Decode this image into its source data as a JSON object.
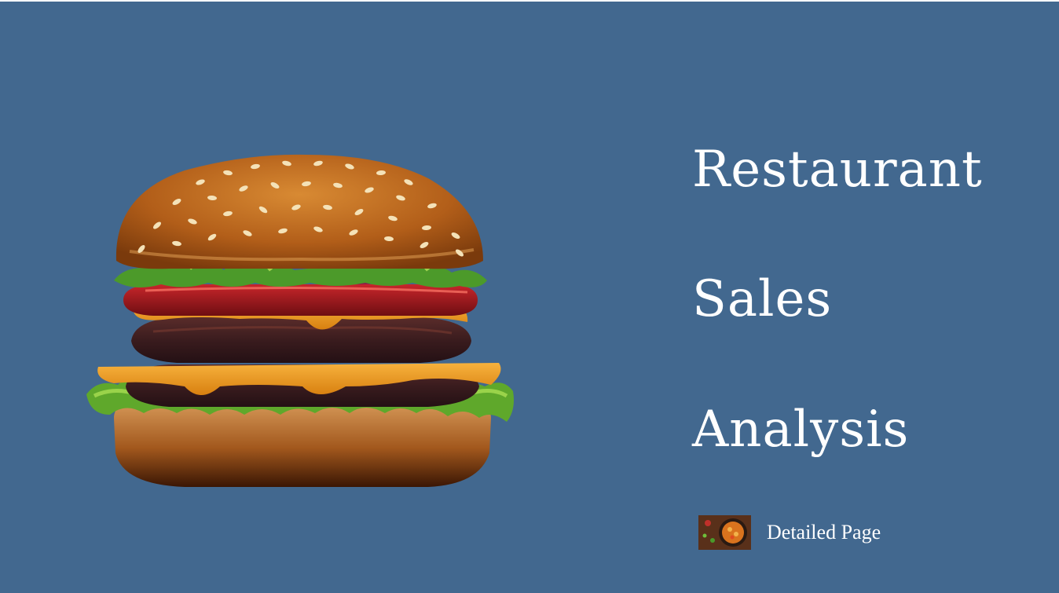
{
  "title": {
    "line1": "Restaurant",
    "line2": "Sales",
    "line3": "Analysis"
  },
  "nav": {
    "detail_link_label": "Detailed Page",
    "detail_link_icon": "food-thumbnail-icon"
  },
  "colors": {
    "background": "#42688f",
    "text": "#ffffff"
  }
}
